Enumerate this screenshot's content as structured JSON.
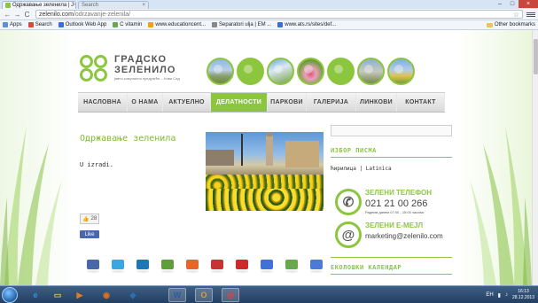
{
  "browser": {
    "tabs": [
      {
        "title": "Одржавање зеленила | Ј",
        "close": "×"
      },
      {
        "title": "Search",
        "close": "×"
      }
    ],
    "window_controls": {
      "minimize": "‒",
      "maximize": "□",
      "close": "×"
    },
    "nav": {
      "back": "←",
      "forward": "→",
      "reload": "C"
    },
    "url_host": "zelenilo.com",
    "url_path": "/odrzavanje-zelenila/",
    "bookmarks": [
      {
        "label": "Apps",
        "color": "#5b8fd6"
      },
      {
        "label": "Search",
        "color": "#d64a3b"
      },
      {
        "label": "Outlook Web App",
        "color": "#3b6fd6"
      },
      {
        "label": "C vitamin",
        "color": "#6aa84f"
      },
      {
        "label": "www.educationcent...",
        "color": "#f2a20c"
      },
      {
        "label": "Separatori ulja | EM ...",
        "color": "#888888"
      },
      {
        "label": "www.ats.rs/sites/def...",
        "color": "#3b6fd6"
      }
    ],
    "other_bookmarks": "Other bookmarks"
  },
  "site": {
    "logo_line1": "ГРАДСКО",
    "logo_line2": "ЗЕЛЕНИЛО",
    "logo_sub": "јавно комунално предузеће – Нови Сад",
    "nav_items": [
      {
        "label": "НАСЛОВНА",
        "active": false
      },
      {
        "label": "О НАМА",
        "active": false
      },
      {
        "label": "АКТУЕЛНО",
        "active": false
      },
      {
        "label": "ДЕЛАТНОСТИ",
        "active": true
      },
      {
        "label": "ПАРКОВИ",
        "active": false
      },
      {
        "label": "ГАЛЕРИЈА",
        "active": false
      },
      {
        "label": "ЛИНКОВИ",
        "active": false
      },
      {
        "label": "КОНТАКТ",
        "active": false
      }
    ],
    "page_title": "Одржавање зеленила",
    "body_text": "U izradi.",
    "like_count": "28",
    "like_label": "Like",
    "share_colors": [
      "#4a67a6",
      "#3aa7e0",
      "#1d77b5",
      "#5f9e3b",
      "#e7672a",
      "#c83232",
      "#cc2a2a",
      "#4170d8",
      "#6aa84f",
      "#4b7bd6"
    ],
    "sidebar": {
      "script_heading": "ИЗБОР ПИСМА",
      "script_options": "Ћирилица | Latinica",
      "phone_label": "ЗЕЛЕНИ ТЕЛЕФОН",
      "phone_number": "021 21 00 266",
      "phone_hours": "Радним данем 07:00 - 15:00 часова",
      "email_label": "ЗЕЛЕНИ Е-МЕЈЛ",
      "email_value": "marketing@zelenilo.com",
      "calendar_heading": "ЕКОЛОШКИ КАЛЕНДАР"
    },
    "accent": "#8cc63f"
  },
  "taskbar": {
    "apps": [
      {
        "name": "internet-explorer",
        "glyph": "e",
        "color": "#3b8ed8"
      },
      {
        "name": "file-explorer",
        "glyph": "▭",
        "color": "#e6c15b"
      },
      {
        "name": "media-player",
        "glyph": "▶",
        "color": "#e07b22"
      },
      {
        "name": "firefox",
        "glyph": "◉",
        "color": "#e2701a"
      },
      {
        "name": "photoshop",
        "glyph": "◆",
        "color": "#2a6fb5"
      },
      {
        "name": "word",
        "glyph": "W",
        "color": "#2b5ca8"
      },
      {
        "name": "outlook",
        "glyph": "O",
        "color": "#d8a12a"
      },
      {
        "name": "chrome",
        "glyph": "◎",
        "color": "#d44b3b"
      }
    ],
    "time": "16:13",
    "date": "28.12.2013",
    "tray_label": "ЕН"
  }
}
